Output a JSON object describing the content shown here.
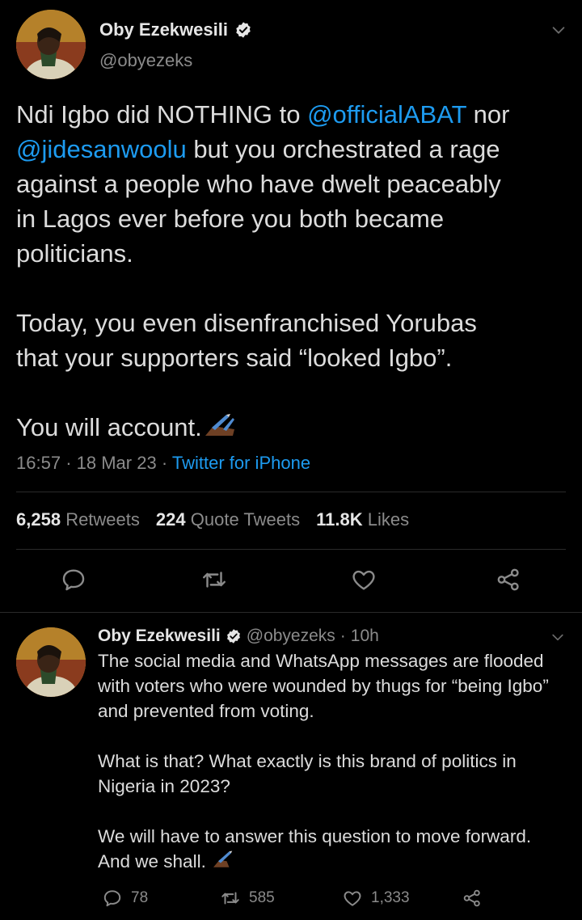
{
  "colors": {
    "background": "#000000",
    "link": "#1d9bf0",
    "muted": "#8b8b8b",
    "text": "#dcdcdc"
  },
  "main_tweet": {
    "author_name": "Oby Ezekwesili",
    "author_handle": "@obyezeks",
    "verified_icon": "verified-badge-icon",
    "body": {
      "line1_pre": "Ndi Igbo did NOTHING to ",
      "mention1": "@officialABAT",
      "line1_post": " nor",
      "mention2": "@jidesanwoolu",
      "line2_post": " but you orchestrated a rage",
      "line3": "against a people who have dwelt peaceably",
      "line4": "in Lagos ever before you both became",
      "line5": "politicians.",
      "para2_line1": "Today, you even disenfranchised Yorubas",
      "para2_line2": "that your supporters said “looked Igbo”.",
      "para3": "You will account."
    },
    "emoji": "writing-hand-emoji",
    "time": "16:57",
    "date": "18 Mar 23",
    "source": "Twitter for iPhone",
    "stats": {
      "retweets_count": "6,258",
      "retweets_label": "Retweets",
      "quotes_count": "224",
      "quotes_label": "Quote Tweets",
      "likes_count": "11.8K",
      "likes_label": "Likes"
    },
    "actions": [
      "reply-icon",
      "retweet-icon",
      "like-icon",
      "share-icon"
    ]
  },
  "reply_tweet": {
    "author_name": "Oby Ezekwesili",
    "author_handle": "@obyezeks",
    "age": "10h",
    "body": {
      "line1": "The social media and WhatsApp messages are flooded",
      "line2": "with voters who were wounded by thugs for “being Igbo”",
      "line3": "and prevented from voting.",
      "p2_line1": "What is that? What exactly is this brand of politics in",
      "p2_line2": "Nigeria in 2023?",
      "p3_line1": "We will have to answer this question to move forward.",
      "p3_line2": "And we shall."
    },
    "counts": {
      "replies": "78",
      "retweets": "585",
      "likes": "1,333"
    }
  }
}
